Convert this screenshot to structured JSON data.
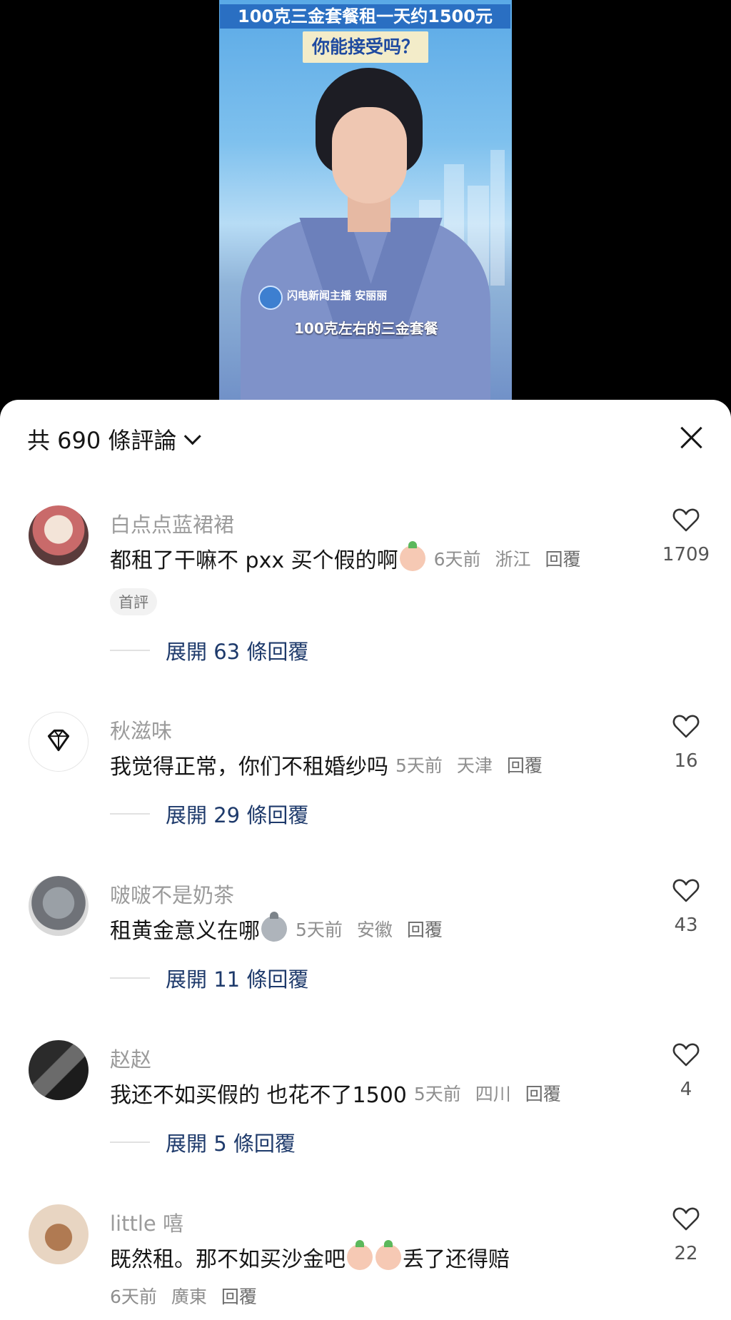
{
  "video": {
    "title": "100克三金套餐租一天约1500元",
    "subtitle": "你能接受吗？",
    "anchor_name": "闪电新闻主播 安丽丽",
    "caption": "100克左右的三金套餐"
  },
  "comments_sheet": {
    "header": "共 690 條評論",
    "comments": [
      {
        "username": "白点点蓝裙裙",
        "text": "都租了干嘛不 pxx 买个假的啊",
        "time": "6天前",
        "location": "浙江",
        "reply": "回覆",
        "likes": "1709",
        "badge": "首評",
        "expand": "展開 63 條回覆",
        "avatar_color": "#c96a6a"
      },
      {
        "username": "秋滋味",
        "text": "我觉得正常，你们不租婚纱吗",
        "time": "5天前",
        "location": "天津",
        "reply": "回覆",
        "likes": "16",
        "expand": "展開 29 條回覆",
        "avatar_color": "#ffffff"
      },
      {
        "username": "啵啵不是奶茶",
        "text": "租黄金意义在哪",
        "time": "5天前",
        "location": "安徽",
        "reply": "回覆",
        "likes": "43",
        "expand": "展開 11 條回覆",
        "avatar_color": "#6f7278"
      },
      {
        "username": "赵赵",
        "text": "我还不如买假的 也花不了1500",
        "time": "5天前",
        "location": "四川",
        "reply": "回覆",
        "likes": "4",
        "expand": "展開 5 條回覆",
        "avatar_color": "#3b3b3b"
      },
      {
        "username": "little 嘻",
        "text_a": "既然租。那不如买沙金吧",
        "text_b": "丢了还得赔",
        "time": "6天前",
        "location": "廣東",
        "reply": "回覆",
        "likes": "22",
        "avatar_color": "#8a6a4e"
      }
    ]
  }
}
